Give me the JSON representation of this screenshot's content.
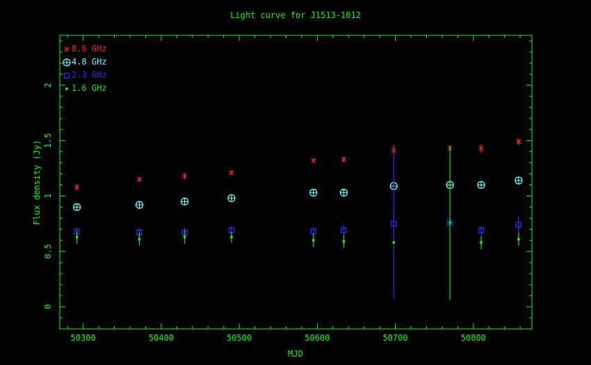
{
  "chart_data": {
    "type": "scatter",
    "title": "Light curve for J1513-1012",
    "xlabel": "MJD",
    "ylabel": "Flux density (Jy)",
    "xlim": [
      50270,
      50875
    ],
    "ylim": [
      -0.2,
      2.45
    ],
    "xticks": [
      50300,
      50400,
      50500,
      50600,
      50700,
      50800
    ],
    "yticks": [
      0,
      0.5,
      1,
      1.5,
      2
    ],
    "grid": false,
    "legend_position": "top-left",
    "colors": {
      "frame": "#00ff00",
      "title": "#00ff00"
    },
    "series": [
      {
        "name": "8.6 GHz",
        "color": "#ff2020",
        "marker": "x",
        "points": [
          {
            "x": 50292,
            "y": 1.08,
            "err": 0.03
          },
          {
            "x": 50372,
            "y": 1.15,
            "err": 0.02
          },
          {
            "x": 50430,
            "y": 1.18,
            "err": 0.03
          },
          {
            "x": 50490,
            "y": 1.21,
            "err": 0.02
          },
          {
            "x": 50595,
            "y": 1.32,
            "err": 0.015
          },
          {
            "x": 50634,
            "y": 1.33,
            "err": 0.025
          },
          {
            "x": 50698,
            "y": 1.41,
            "err": 0.05
          },
          {
            "x": 50770,
            "y": 1.43,
            "err": 0.03
          },
          {
            "x": 50810,
            "y": 1.43,
            "err": 0.04
          },
          {
            "x": 50858,
            "y": 1.49,
            "err": 0.03
          }
        ]
      },
      {
        "name": "4.8 GHz",
        "color": "#66ffff",
        "marker": "circle-plus",
        "points": [
          {
            "x": 50292,
            "y": 0.9,
            "err": 0.015
          },
          {
            "x": 50372,
            "y": 0.92,
            "err": 0.015
          },
          {
            "x": 50430,
            "y": 0.95,
            "err": 0.015
          },
          {
            "x": 50490,
            "y": 0.98,
            "err": 0.015
          },
          {
            "x": 50595,
            "y": 1.03,
            "err": 0.015
          },
          {
            "x": 50634,
            "y": 1.03,
            "err": 0.03
          },
          {
            "x": 50698,
            "y": 1.09,
            "err": 0.03
          },
          {
            "x": 50770,
            "y": 1.1,
            "err": 0.03
          },
          {
            "x": 50810,
            "y": 1.1,
            "err": 0.015
          },
          {
            "x": 50858,
            "y": 1.14,
            "err": 0.015
          }
        ]
      },
      {
        "name": "2.3 GHz",
        "color": "#2030ff",
        "marker": "square",
        "points": [
          {
            "x": 50292,
            "y": 0.68,
            "err": 0.03
          },
          {
            "x": 50372,
            "y": 0.67,
            "err": 0.04
          },
          {
            "x": 50430,
            "y": 0.67,
            "err": 0.04
          },
          {
            "x": 50490,
            "y": 0.69,
            "err": 0.04
          },
          {
            "x": 50595,
            "y": 0.68,
            "err": 0.04
          },
          {
            "x": 50634,
            "y": 0.69,
            "err": 0.05
          },
          {
            "x": 50698,
            "y": 0.75,
            "err": 0.67
          },
          {
            "x": 50770,
            "y": 0.76,
            "err": 0.02
          },
          {
            "x": 50810,
            "y": 0.69,
            "err": 0.04
          },
          {
            "x": 50858,
            "y": 0.74,
            "err": 0.08
          }
        ]
      },
      {
        "name": "1.6 GHz",
        "color": "#20e020",
        "marker": "dot",
        "points": [
          {
            "x": 50292,
            "y": 0.63,
            "err": 0.06
          },
          {
            "x": 50372,
            "y": 0.61,
            "err": 0.06
          },
          {
            "x": 50430,
            "y": 0.63,
            "err": 0.06
          },
          {
            "x": 50490,
            "y": 0.63,
            "err": 0.05
          },
          {
            "x": 50595,
            "y": 0.6,
            "err": 0.06
          },
          {
            "x": 50634,
            "y": 0.59,
            "err": 0.06
          },
          {
            "x": 50698,
            "y": 0.58,
            "err": 0.01
          },
          {
            "x": 50770,
            "y": 0.76,
            "err": 0.7
          },
          {
            "x": 50810,
            "y": 0.58,
            "err": 0.06
          },
          {
            "x": 50858,
            "y": 0.61,
            "err": 0.06
          }
        ]
      }
    ]
  }
}
